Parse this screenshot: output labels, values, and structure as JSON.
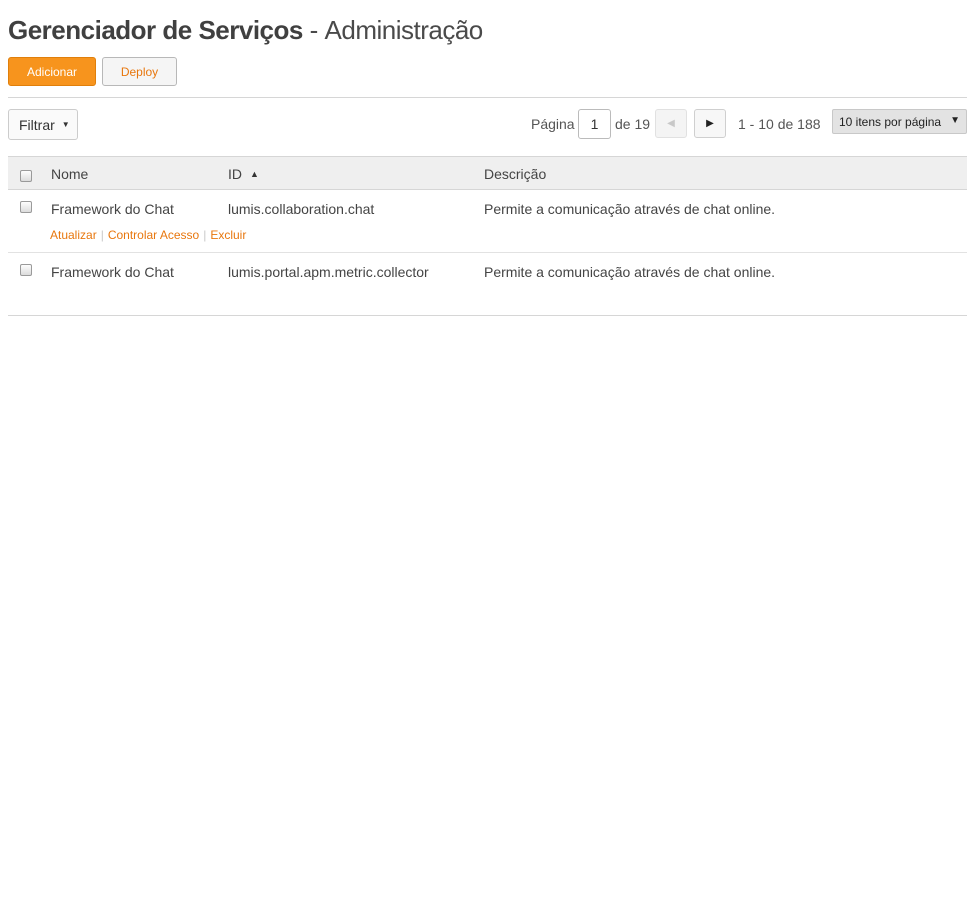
{
  "header": {
    "title_strong": "Gerenciador de Serviços",
    "title_separator": "-",
    "title_light": "Administração"
  },
  "toolbar": {
    "add_label": "Adicionar",
    "deploy_label": "Deploy"
  },
  "filter": {
    "label": "Filtrar",
    "caret_icon": "caret-down-icon"
  },
  "pagination": {
    "page_label": "Página",
    "current_page": "1",
    "of_label": "de 19",
    "range_label": "1 - 10 de 188",
    "per_page_selected": "10 itens por página",
    "prev_icon": "triangle-left-icon",
    "next_icon": "triangle-right-icon"
  },
  "table": {
    "columns": {
      "nome": "Nome",
      "id": "ID",
      "descricao": "Descrição"
    },
    "sort_column": "id",
    "sort_direction": "asc",
    "rows": [
      {
        "nome": "Framework do Chat",
        "id": "lumis.collaboration.chat",
        "descricao": "Permite a comunicação através de chat online.",
        "actions": {
          "atualizar": "Atualizar",
          "controlar_acesso": "Controlar Acesso",
          "excluir": "Excluir",
          "separator": "|"
        }
      },
      {
        "nome": "Framework do Chat",
        "id": "lumis.portal.apm.metric.collector",
        "descricao": "Permite a comunicação através de chat online."
      }
    ]
  },
  "colors": {
    "primary": "#f7941d",
    "link": "#e8770e",
    "header_bg": "#efefef"
  }
}
